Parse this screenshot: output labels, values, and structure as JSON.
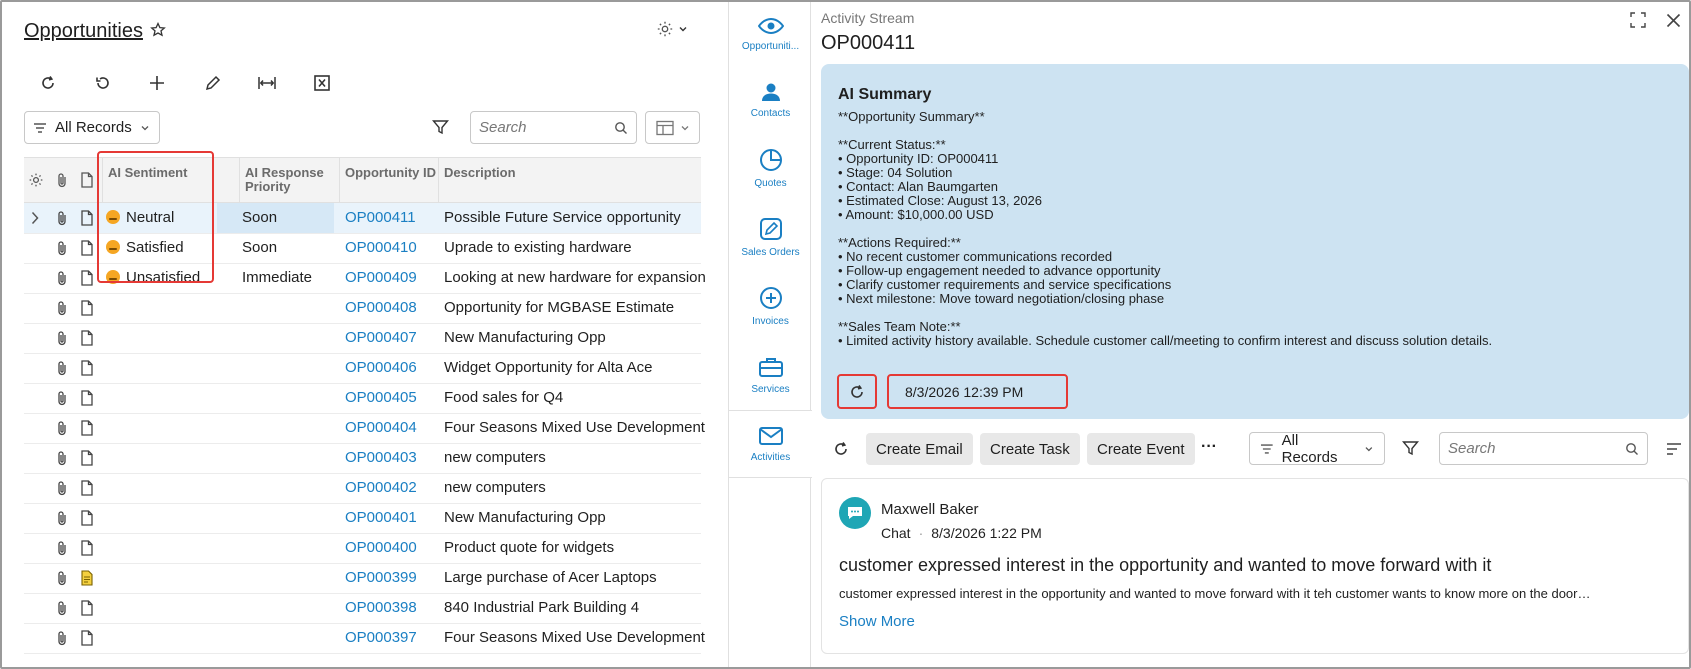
{
  "header": {
    "title": "Opportunities"
  },
  "filters": {
    "records_label": "All Records",
    "search_placeholder": "Search"
  },
  "grid": {
    "columns": [
      "AI Sentiment",
      "AI Response Priority",
      "Opportunity ID",
      "Description"
    ],
    "rows": [
      {
        "sentiment": "Neutral",
        "priority": "Soon",
        "id": "OP000411",
        "description": "Possible Future Service opportunity"
      },
      {
        "sentiment": "Satisfied",
        "priority": "Soon",
        "id": "OP000410",
        "description": "Uprade to existing hardware"
      },
      {
        "sentiment": "Unsatisfied",
        "priority": "Immediate",
        "id": "OP000409",
        "description": "Looking at new hardware for expansion"
      },
      {
        "sentiment": "",
        "priority": "",
        "id": "OP000408",
        "description": "Opportunity for MGBASE Estimate"
      },
      {
        "sentiment": "",
        "priority": "",
        "id": "OP000407",
        "description": "New Manufacturing Opp"
      },
      {
        "sentiment": "",
        "priority": "",
        "id": "OP000406",
        "description": "Widget Opportunity for Alta Ace"
      },
      {
        "sentiment": "",
        "priority": "",
        "id": "OP000405",
        "description": "Food sales for Q4"
      },
      {
        "sentiment": "",
        "priority": "",
        "id": "OP000404",
        "description": "Four Seasons Mixed Use Development"
      },
      {
        "sentiment": "",
        "priority": "",
        "id": "OP000403",
        "description": "new computers"
      },
      {
        "sentiment": "",
        "priority": "",
        "id": "OP000402",
        "description": "new computers"
      },
      {
        "sentiment": "",
        "priority": "",
        "id": "OP000401",
        "description": "New Manufacturing Opp"
      },
      {
        "sentiment": "",
        "priority": "",
        "id": "OP000400",
        "description": "Product quote for widgets"
      },
      {
        "sentiment": "",
        "priority": "",
        "id": "OP000399",
        "description": "Large purchase of Acer Laptops"
      },
      {
        "sentiment": "",
        "priority": "",
        "id": "OP000398",
        "description": "840 Industrial Park Building 4"
      },
      {
        "sentiment": "",
        "priority": "",
        "id": "OP000397",
        "description": "Four Seasons Mixed Use Development"
      }
    ]
  },
  "sidenav": {
    "items": [
      {
        "label": "Opportuniti...",
        "icon": "eye-icon"
      },
      {
        "label": "Contacts",
        "icon": "person-icon"
      },
      {
        "label": "Quotes",
        "icon": "pie-icon"
      },
      {
        "label": "Sales Orders",
        "icon": "edit-icon"
      },
      {
        "label": "Invoices",
        "icon": "plus-circle-icon"
      },
      {
        "label": "Services",
        "icon": "briefcase-icon"
      },
      {
        "label": "Activities",
        "icon": "mail-icon"
      }
    ]
  },
  "activity": {
    "label": "Activity Stream",
    "record_id": "OP000411",
    "ai": {
      "title": "AI Summary",
      "lines": [
        "**Opportunity Summary**",
        "",
        "**Current Status:**",
        "• Opportunity ID: OP000411",
        "• Stage: 04 Solution",
        "• Contact: Alan Baumgarten",
        "• Estimated Close: August 13, 2026",
        "• Amount: $10,000.00 USD",
        "",
        "**Actions Required:**",
        "• No recent customer communications recorded",
        "• Follow-up engagement needed to advance opportunity",
        "• Clarify customer requirements and service specifications",
        "• Next milestone: Move toward negotiation/closing phase",
        "",
        "**Sales Team Note:**",
        "• Limited activity history available. Schedule customer call/meeting to confirm interest and discuss solution details."
      ],
      "timestamp": "8/3/2026 12:39 PM"
    },
    "toolbar": {
      "create_email": "Create Email",
      "create_task": "Create Task",
      "create_event": "Create Event",
      "more": "···",
      "records_label": "All Records",
      "search_placeholder": "Search"
    },
    "card": {
      "author": "Maxwell Baker",
      "type": "Chat",
      "sep": "·",
      "time": "8/3/2026 1:22 PM",
      "subject": "customer expressed interest in the opportunity and wanted to move forward with it",
      "body": "customer expressed interest in the opportunity and wanted to move forward with it teh customer wants to know more on the door…",
      "show_more": "Show More"
    }
  },
  "colors": {
    "accent": "#1a7fc3",
    "highlight": "#e53935",
    "ai_bg": "#cde3f2"
  }
}
